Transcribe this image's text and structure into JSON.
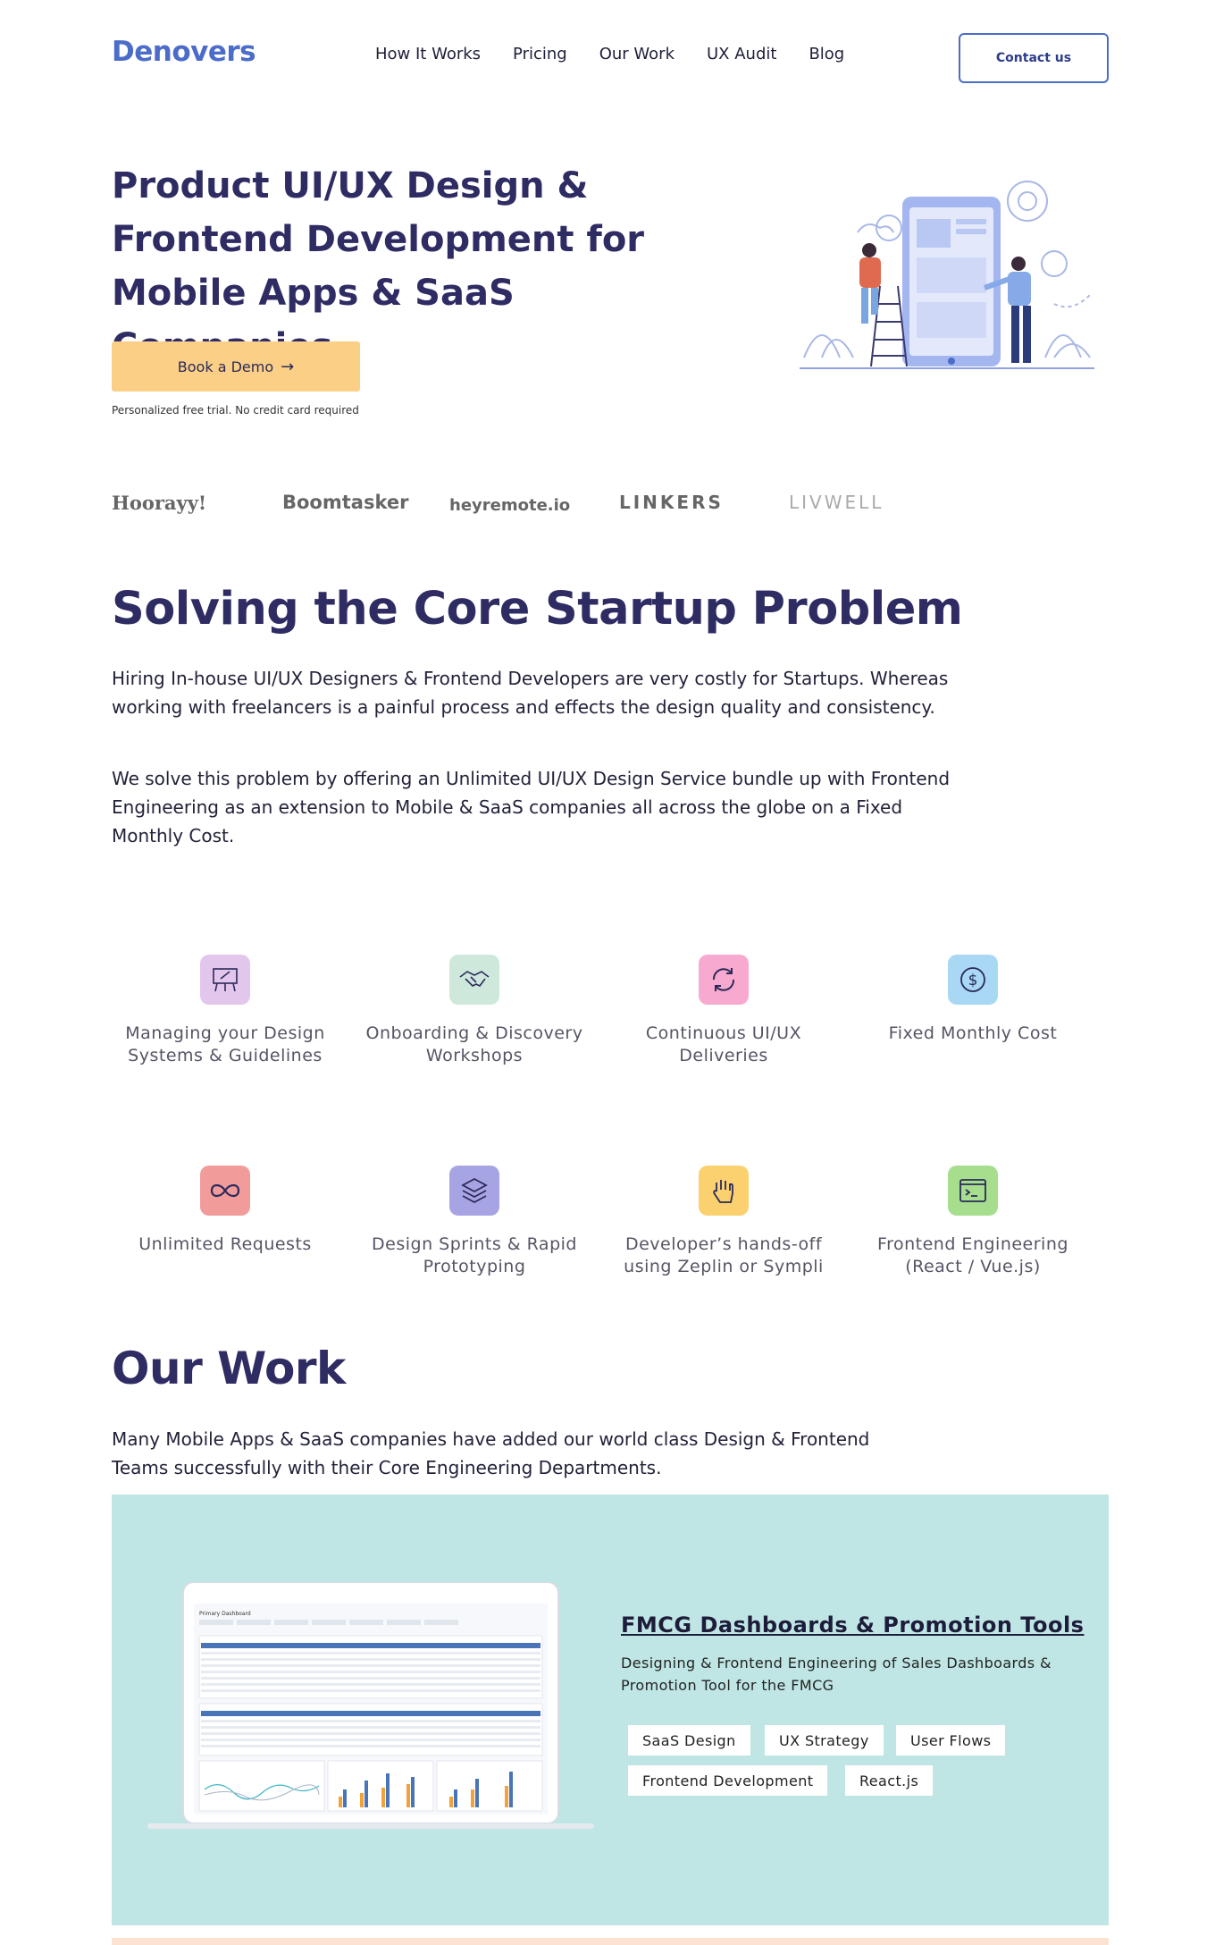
{
  "brand": {
    "logo_text": "Denovers",
    "accent": "#4b6cc9"
  },
  "nav": {
    "items": [
      "How It Works",
      "Pricing",
      "Our Work",
      "UX Audit",
      "Blog"
    ],
    "contact_label": "Contact us"
  },
  "hero": {
    "title": "Product UI/UX Design & Frontend Development for Mobile Apps & SaaS Companies",
    "cta_label": "Book a Demo",
    "note": "Personalized free trial. No credit card required"
  },
  "clients": [
    "Hoorayy!",
    "Boomtasker",
    "heyremote.io",
    "LINKERS",
    "LIVWELL"
  ],
  "problem": {
    "title": "Solving the Core Startup Problem",
    "p1": "Hiring In-house UI/UX Designers & Frontend Developers are very costly for Startups. Whereas working with freelancers is a painful process and effects the design quality and consistency.",
    "p2": "We solve this problem by offering an Unlimited UI/UX Design Service bundle up with Frontend Engineering as an extension to Mobile & SaaS companies all across the globe on a Fixed Monthly Cost."
  },
  "features": [
    {
      "label": "Managing your Design Systems & Guidelines",
      "icon": "design-board-icon",
      "color": "#e3c6ec"
    },
    {
      "label": "Onboarding & Discovery Workshops",
      "icon": "handshake-icon",
      "color": "#cfe8dc"
    },
    {
      "label": "Continuous UI/UX Deliveries",
      "icon": "refresh-icon",
      "color": "#f7a9cf"
    },
    {
      "label": "Fixed Monthly Cost",
      "icon": "dollar-icon",
      "color": "#a9d8f5"
    },
    {
      "label": "Unlimited Requests",
      "icon": "infinity-icon",
      "color": "#f19b9b"
    },
    {
      "label": "Design Sprints & Rapid Prototyping",
      "icon": "layers-icon",
      "color": "#a7a4e4"
    },
    {
      "label": "Developer’s hands-off using Zeplin or Sympli",
      "icon": "hand-icon",
      "color": "#fbd06e"
    },
    {
      "label": "Frontend Engineering (React / Vue.js)",
      "icon": "terminal-icon",
      "color": "#a6de8d"
    }
  ],
  "work": {
    "title": "Our Work",
    "intro": "Many Mobile Apps & SaaS companies have added our world class Design & Frontend Teams successfully with their Core Engineering Departments.",
    "project": {
      "title": "FMCG Dashboards & Promotion Tools",
      "description": "Designing & Frontend Engineering of Sales Dashboards & Promotion Tool for the FMCG",
      "tags": [
        "SaaS Design",
        "UX Strategy",
        "User Flows",
        "Frontend Development",
        "React.js"
      ],
      "screen_title": "Primary Dashboard"
    }
  }
}
